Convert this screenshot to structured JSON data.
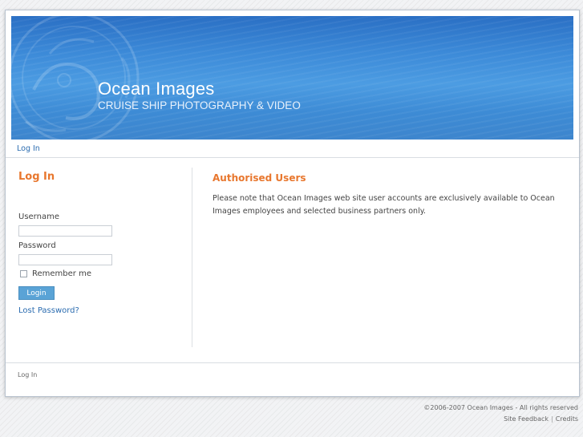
{
  "header": {
    "title": "Ocean Images",
    "tagline": "CRUISE SHIP PHOTOGRAPHY & VIDEO"
  },
  "breadcrumb": {
    "current": "Log In"
  },
  "login_form": {
    "title": "Log In",
    "username_label": "Username",
    "username_value": "",
    "password_label": "Password",
    "password_value": "",
    "remember_label": "Remember me",
    "remember_checked": false,
    "submit_label": "Login",
    "lost_password_label": "Lost Password?"
  },
  "main": {
    "title": "Authorised Users",
    "body": "Please note that Ocean Images web site user accounts are exclusively available to Ocean Images employees and selected business partners only."
  },
  "footer": {
    "nav_link": "Log In",
    "copyright": "©2006-2007 Ocean Images - All rights reserved",
    "site_feedback": "Site Feedback",
    "separator": "|",
    "credits": "Credits"
  },
  "colors": {
    "accent_orange": "#e8772e",
    "link_blue": "#2b6cb0",
    "button_blue": "#5aa3d6",
    "banner_blue": "#3c8ad8"
  }
}
